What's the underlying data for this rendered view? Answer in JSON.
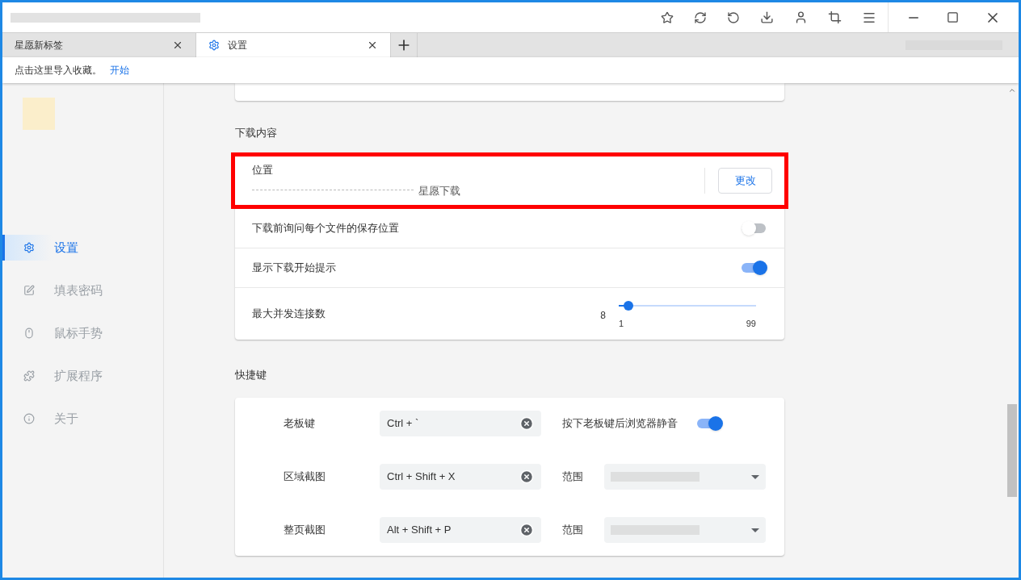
{
  "tabs": [
    {
      "label": "星愿新标签",
      "selected": false
    },
    {
      "label": "设置",
      "selected": true
    }
  ],
  "bookmark_bar": {
    "text": "点击这里导入收藏。",
    "link": "开始"
  },
  "sidebar": {
    "items": [
      {
        "kind": "gear",
        "label": "设置",
        "selected": true
      },
      {
        "kind": "form",
        "label": "填表密码",
        "selected": false
      },
      {
        "kind": "mouse",
        "label": "鼠标手势",
        "selected": false
      },
      {
        "kind": "puzzle",
        "label": "扩展程序",
        "selected": false
      },
      {
        "kind": "info",
        "label": "关于",
        "selected": false
      }
    ]
  },
  "downloads": {
    "heading": "下载内容",
    "location": {
      "label": "位置",
      "path": "星愿下载",
      "button": "更改"
    },
    "rows": [
      {
        "kind": "toggle",
        "label": "下载前询问每个文件的保存位置",
        "on": false
      },
      {
        "kind": "toggle",
        "label": "显示下载开始提示",
        "on": true
      },
      {
        "kind": "slider",
        "label": "最大并发连接数",
        "reading": "8",
        "min": "1",
        "max": "99",
        "level": 0.07
      }
    ]
  },
  "shortcuts": {
    "heading": "快捷键",
    "rows": [
      {
        "label": "老板键",
        "value": "Ctrl + `",
        "option": {
          "kind": "toggle",
          "label": "按下老板键后浏览器静音",
          "on": true
        }
      },
      {
        "label": "区域截图",
        "value": "Ctrl + Shift + X",
        "option": {
          "kind": "select",
          "label": "范围"
        }
      },
      {
        "label": "整页截图",
        "value": "Alt + Shift + P",
        "option": {
          "kind": "select",
          "label": "范围"
        }
      }
    ]
  }
}
